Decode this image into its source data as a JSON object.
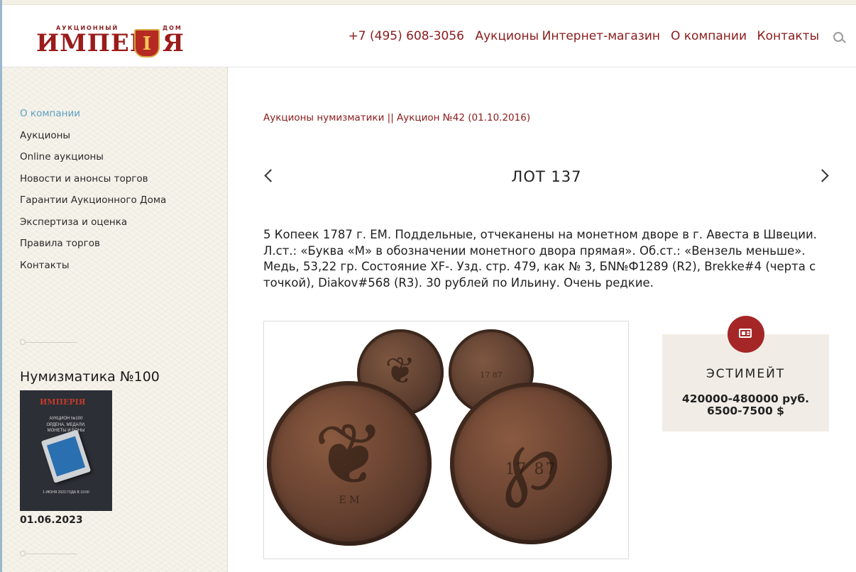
{
  "header": {
    "logo": {
      "small_top": "АУКЦИОННЫЙ",
      "small_right": "ДОМ",
      "main_left": "ИМПЕР",
      "shield_letter": "І",
      "main_right": "Я"
    },
    "nav": {
      "phone": "+7 (495) 608-3056",
      "items": [
        "Аукционы",
        "Интернет-магазин",
        "О компании",
        "Контакты"
      ]
    }
  },
  "sidebar": {
    "items": [
      {
        "label": "О компании",
        "active": true
      },
      {
        "label": "Аукционы"
      },
      {
        "label": "Online аукционы"
      },
      {
        "label": "Новости и анонсы торгов"
      },
      {
        "label": "Гарантии Аукционного Дома"
      },
      {
        "label": "Экспертиза и оценка"
      },
      {
        "label": "Правила торгов"
      },
      {
        "label": "Контакты"
      }
    ],
    "catalog": {
      "title": "Нумизматика №100",
      "cover": {
        "logo": "ИМПЕРІЯ",
        "line1": "АУКЦИОН №100",
        "line2": "ОРДЕНА, МЕДАЛИ,",
        "line3": "МОНЕТЫ И БОНЫ",
        "footer": "1 ИЮНЯ 2023 ГОДА В 19:00"
      },
      "date": "01.06.2023"
    }
  },
  "main": {
    "breadcrumb": "Аукционы нумизматики || Аукцион №42 (01.10.2016)",
    "lot_title": "ЛОТ 137",
    "description": "5 Копеек 1787 г. ЕМ. Поддельные, отчеканены на монетном дворе в г. Авеста в Швеции. Л.ст.: «Буква «М» в обозначении монетного двора прямая». Об.ст.: «Вензель меньше». Медь, 53,22 гр. Состояние XF-. Узд. стр. 479, как № 3, БN№Ф1289 (R2), Brekke#4 (черта с точкой), Diakov#568 (R3). 30 рублей по Ильину. Очень редкие.",
    "photo": {
      "big_obverse_glyph": "❦",
      "big_reverse_glyph": "℘",
      "reverse_year": "17   87",
      "obverse_letters": "Е      М",
      "small_reverse_year": "17  87"
    },
    "estimate": {
      "title": "ЭСТИМЕЙТ",
      "rub": "420000-480000 руб.",
      "usd": "6500-7500 $"
    }
  }
}
